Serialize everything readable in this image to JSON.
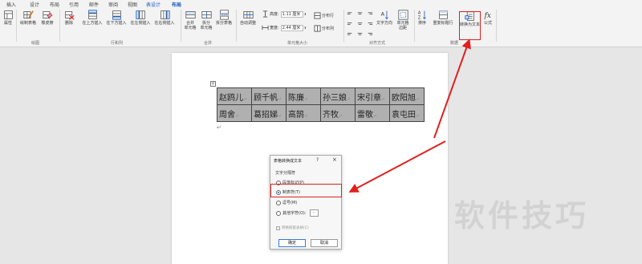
{
  "tabs": [
    {
      "label": "插入",
      "active": false
    },
    {
      "label": "设计",
      "active": false
    },
    {
      "label": "布局",
      "active": false
    },
    {
      "label": "引用",
      "active": false
    },
    {
      "label": "邮件",
      "active": false
    },
    {
      "label": "审阅",
      "active": false
    },
    {
      "label": "视图",
      "active": false
    },
    {
      "label": "表设计",
      "active": false
    },
    {
      "label": "布局",
      "active": true
    }
  ],
  "ribbon": {
    "properties": "属性",
    "draw_table": "绘制表格",
    "eraser": "橡皮擦",
    "group_draw": "绘图",
    "delete": "删除",
    "insert_above": "在上方插入",
    "insert_below": "在下方插入",
    "insert_left": "在左侧插入",
    "insert_right": "在右侧插入",
    "group_rows_cols": "行和列",
    "merge_cells": "合并\n单元格",
    "split_cells": "拆分\n单元格",
    "split_table": "拆分表格",
    "group_merge": "合并",
    "autofit": "自动调整",
    "height_label": "高度:",
    "height_value": "1.11 厘米",
    "width_label": "宽度:",
    "width_value": "2.44 厘米",
    "distribute_rows": "分布行",
    "distribute_cols": "分布列",
    "group_cell_size": "单元格大小",
    "text_direction": "文字方向",
    "cell_margins": "单元格\n边距",
    "group_alignment": "对齐方式",
    "sort": "排序",
    "repeat_header": "重复标题行",
    "convert_to_text": "转换为文本",
    "formula": "公式",
    "group_data": "数据"
  },
  "table": {
    "rows": [
      [
        "赵鸥儿",
        "顾千帆",
        "陈廉",
        "孙三娘",
        "宋引章",
        "欧阳旭"
      ],
      [
        "周舍",
        "葛招娣",
        "高鹄",
        "齐牧",
        "雷敬",
        "袁屯田"
      ]
    ],
    "cell_mark": "↵",
    "para_mark": "↵"
  },
  "dialog": {
    "title": "表格转换成文本",
    "help": "?",
    "close": "×",
    "group_label": "文字分隔符",
    "options": [
      {
        "label": "段落标记(P)",
        "selected": false
      },
      {
        "label": "制表符(T)",
        "selected": true
      },
      {
        "label": "逗号(M)",
        "selected": false
      },
      {
        "label": "其他字符(O):",
        "selected": false
      }
    ],
    "other_value": "-",
    "nested_label": "转换嵌套表格(C)",
    "ok": "确定",
    "cancel": "取消"
  },
  "watermark": "软件技巧",
  "colors": {
    "accent": "#185abd",
    "highlight": "#e02020"
  }
}
